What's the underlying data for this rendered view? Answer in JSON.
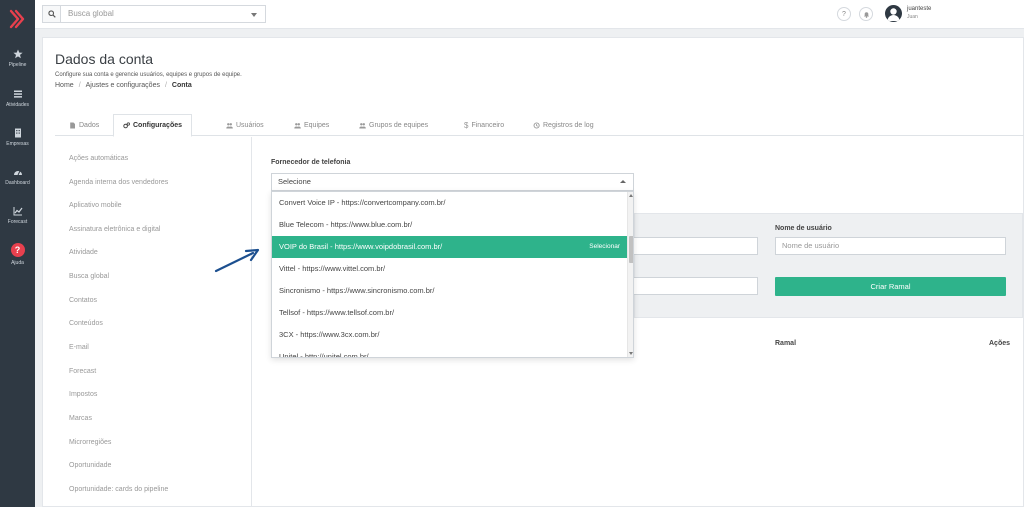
{
  "topbar": {
    "search_placeholder": "Busca global",
    "help_label": "?",
    "user_name": "juanteste",
    "user_sub": "Juan"
  },
  "sidebar": {
    "items": [
      {
        "label": "Pipeline",
        "icon": "star-icon"
      },
      {
        "label": "Atividades",
        "icon": "list-icon"
      },
      {
        "label": "Empresas",
        "icon": "building-icon"
      },
      {
        "label": "Dashboard",
        "icon": "gauge-icon"
      },
      {
        "label": "Forecast",
        "icon": "chart-line-icon"
      },
      {
        "label": "Ajuda",
        "icon": "question-icon"
      }
    ]
  },
  "page": {
    "title": "Dados da conta",
    "subtitle": "Configure sua conta e gerencie usuários, equipes e grupos de equipe.",
    "breadcrumb": [
      "Home",
      "Ajustes e configurações",
      "Conta"
    ]
  },
  "tabs": [
    {
      "label": "Dados",
      "icon": "file-icon"
    },
    {
      "label": "Configurações",
      "icon": "gears-icon",
      "active": true
    },
    {
      "label": "Usuários",
      "icon": "users-icon"
    },
    {
      "label": "Equipes",
      "icon": "team-icon"
    },
    {
      "label": "Grupos de equipes",
      "icon": "groups-icon"
    },
    {
      "label": "Financeiro",
      "icon": "dollar-icon"
    },
    {
      "label": "Registros de log",
      "icon": "history-icon"
    }
  ],
  "menu": [
    "Ações automáticas",
    "Agenda interna dos vendedores",
    "Aplicativo mobile",
    "Assinatura eletrônica e digital",
    "Atividade",
    "Busca global",
    "Contatos",
    "Conteúdos",
    "E-mail",
    "Forecast",
    "Impostos",
    "Marcas",
    "Microrregiões",
    "Oportunidade",
    "Oportunidade: cards do pipeline"
  ],
  "telefonia": {
    "label": "Fornecedor de telefonia",
    "selected": "Selecione",
    "options": [
      "Convert Voice IP - https://convertcompany.com.br/",
      "Blue Telecom - https://www.blue.com.br/",
      "VOIP do Brasil - https://www.voipdobrasil.com.br/",
      "Vittel - https://www.vittel.com.br/",
      "Sincronismo - https://www.sincronismo.com.br/",
      "Tellsof - https://www.tellsof.com.br/",
      "3CX - https://www.3cx.com.br/",
      "Unitel - http://unitel.com.br/"
    ],
    "highlighted_hint": "Selecionar"
  },
  "ramal": {
    "username_label": "Nome de usuário",
    "username_placeholder": "Nome de usuário",
    "create_button": "Criar Ramal",
    "col_ramal": "Ramal",
    "col_acoes": "Ações"
  },
  "colors": {
    "accent": "#2eb38b",
    "sidebar": "#2f3943",
    "help": "#e8404e",
    "arrow": "#1c4f8f"
  }
}
